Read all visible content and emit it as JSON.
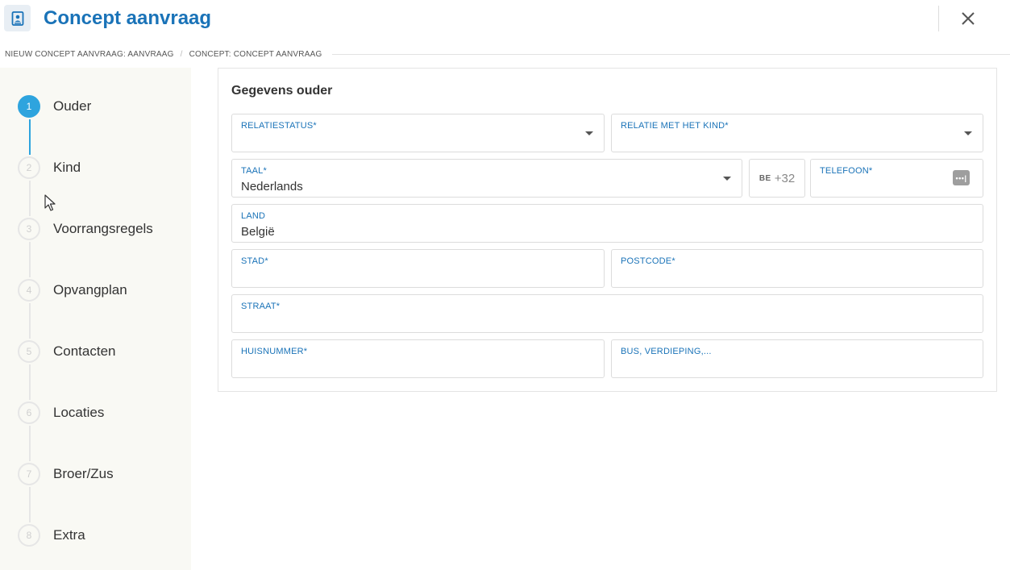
{
  "header": {
    "title": "Concept aanvraag",
    "app_icon": "contact-book-icon",
    "close_icon": "close-icon"
  },
  "breadcrumb": {
    "items": [
      "NIEUW CONCEPT AANVRAAG: AANVRAAG",
      "CONCEPT: CONCEPT AANVRAAG"
    ],
    "separator": "/"
  },
  "steps": [
    {
      "number": "1",
      "label": "Ouder",
      "active": true
    },
    {
      "number": "2",
      "label": "Kind",
      "active": false
    },
    {
      "number": "3",
      "label": "Voorrangsregels",
      "active": false
    },
    {
      "number": "4",
      "label": "Opvangplan",
      "active": false
    },
    {
      "number": "5",
      "label": "Contacten",
      "active": false
    },
    {
      "number": "6",
      "label": "Locaties",
      "active": false
    },
    {
      "number": "7",
      "label": "Broer/Zus",
      "active": false
    },
    {
      "number": "8",
      "label": "Extra",
      "active": false
    }
  ],
  "form": {
    "title": "Gegevens ouder",
    "relatiestatus": {
      "label": "RELATIESTATUS*",
      "value": ""
    },
    "relatie": {
      "label": "RELATIE MET HET KIND*",
      "value": ""
    },
    "taal": {
      "label": "TAAL*",
      "value": "Nederlands"
    },
    "phone_prefix": {
      "flag": "BE",
      "code": "+32"
    },
    "telefoon": {
      "label": "TELEFOON*",
      "value": "",
      "icon_text": "•••|"
    },
    "land": {
      "label": "LAND",
      "value": "België"
    },
    "stad": {
      "label": "STAD*",
      "value": ""
    },
    "postcode": {
      "label": "POSTCODE*",
      "value": ""
    },
    "straat": {
      "label": "STRAAT*",
      "value": ""
    },
    "huisnummer": {
      "label": "HUISNUMMER*",
      "value": ""
    },
    "bus": {
      "label": "BUS, VERDIEPING,...",
      "value": ""
    }
  },
  "colors": {
    "accent": "#1a73b8",
    "step_active": "#2ea4de",
    "sidebar_bg": "#f9f9f4",
    "border": "#dcdcdc"
  }
}
